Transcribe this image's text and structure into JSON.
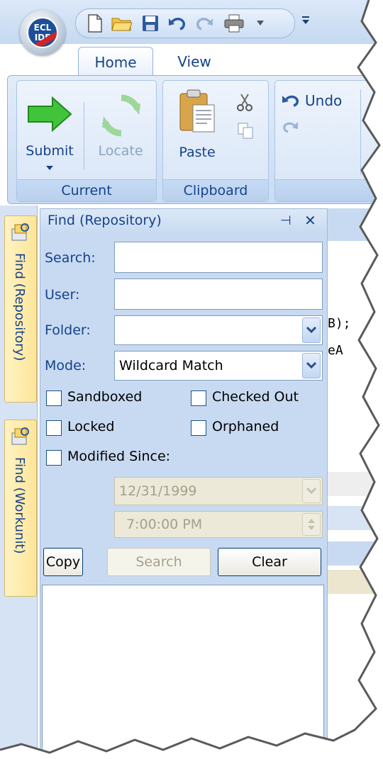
{
  "app": {
    "logo_line1": "ECL",
    "logo_line2": "IDE"
  },
  "quick_access": {
    "icons": [
      "new-icon",
      "open-folder-icon",
      "save-icon",
      "undo-icon",
      "redo-icon",
      "print-icon",
      "dropdown-arrow-icon"
    ]
  },
  "tabs": [
    {
      "label": "Home",
      "active": true
    },
    {
      "label": "View",
      "active": false
    }
  ],
  "ribbon": {
    "groups": {
      "current": {
        "label": "Current",
        "submit": "Submit",
        "locate": "Locate"
      },
      "clipboard": {
        "label": "Clipboard",
        "paste": "Paste"
      },
      "edit": {
        "undo": "Undo"
      }
    }
  },
  "side_tabs": [
    {
      "label": "Find (Repository)"
    },
    {
      "label": "Find (Workunit)"
    }
  ],
  "find_panel": {
    "title": "Find (Repository)",
    "pin_glyph": "⊣",
    "close_glyph": "✕",
    "search_label": "Search:",
    "search_value": "",
    "user_label": "User:",
    "user_value": "",
    "folder_label": "Folder:",
    "folder_value": "",
    "mode_label": "Mode:",
    "mode_value": "Wildcard Match",
    "checkboxes": {
      "sandboxed": {
        "label": "Sandboxed",
        "checked": false
      },
      "checked_out": {
        "label": "Checked Out",
        "checked": false
      },
      "locked": {
        "label": "Locked",
        "checked": false
      },
      "orphaned": {
        "label": "Orphaned",
        "checked": false
      },
      "modified_since": {
        "label": "Modified Since:",
        "checked": false
      }
    },
    "date_value": "12/31/1999",
    "time_value": "7:00:00 PM",
    "buttons": {
      "copy": "Copy",
      "search": "Search",
      "clear": "Clear"
    }
  },
  "editor": {
    "line1": "B);",
    "line2": "eA"
  },
  "colors": {
    "ribbon_text": "#15428b",
    "panel_bg": "#c8daf1",
    "side_tab_bg": "#fde59a"
  }
}
